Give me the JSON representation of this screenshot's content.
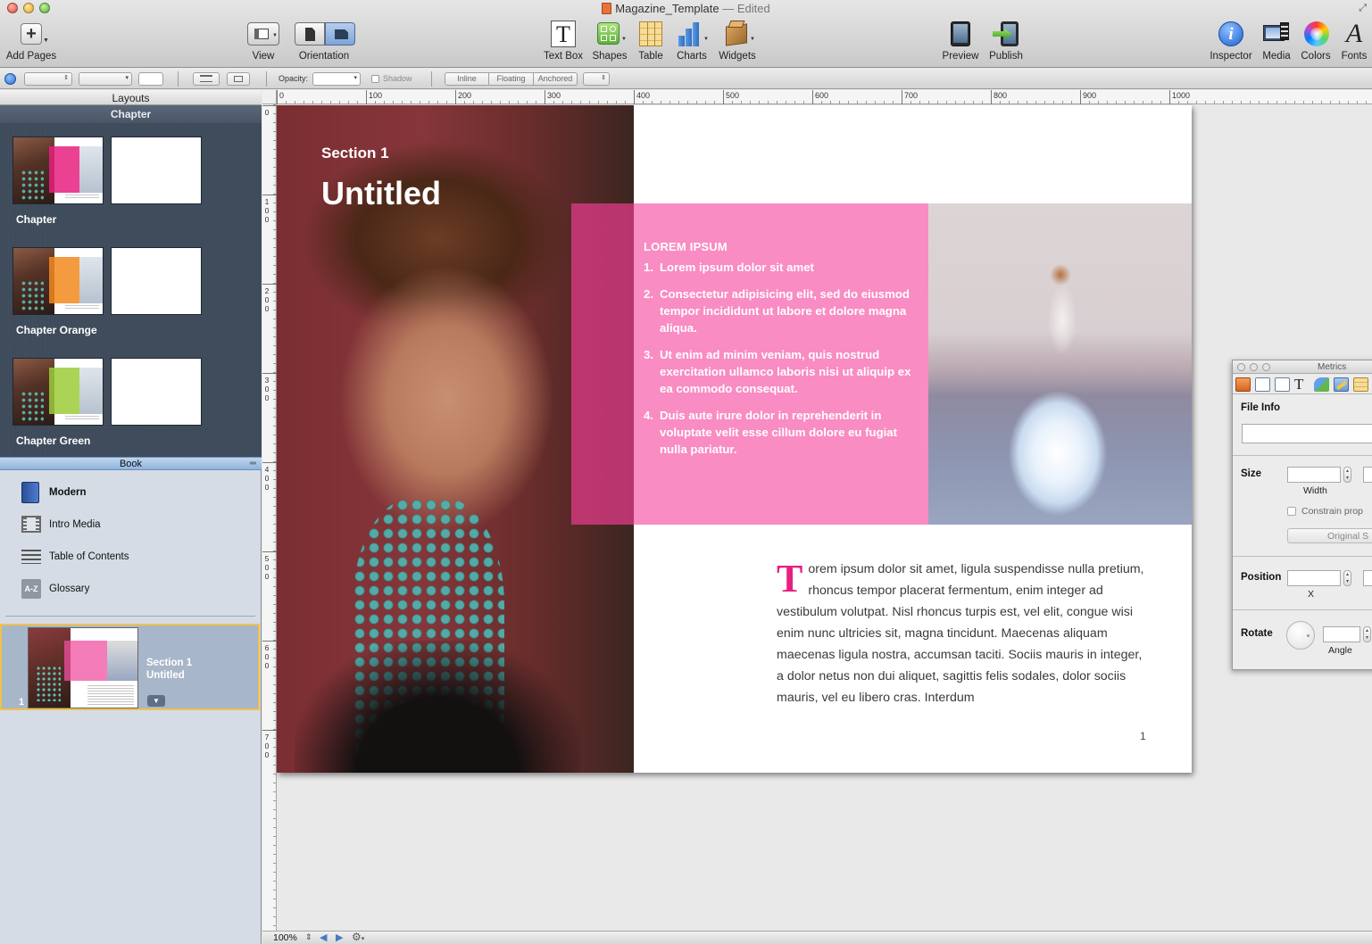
{
  "window": {
    "title": "Magazine_Template",
    "edited": "— Edited"
  },
  "toolbar": {
    "add_pages": "Add Pages",
    "view": "View",
    "orientation": "Orientation",
    "text_box": "Text Box",
    "shapes": "Shapes",
    "table": "Table",
    "charts": "Charts",
    "widgets": "Widgets",
    "preview": "Preview",
    "publish": "Publish",
    "inspector": "Inspector",
    "media": "Media",
    "colors": "Colors",
    "fonts": "Fonts"
  },
  "format_bar": {
    "opacity_label": "Opacity:",
    "shadow_label": "Shadow",
    "wrap_inline": "Inline",
    "wrap_floating": "Floating",
    "wrap_anchored": "Anchored"
  },
  "sidebar": {
    "layouts_header": "Layouts",
    "chapter_bar": "Chapter",
    "layouts": [
      {
        "label": "Chapter",
        "accent": "#e8207f"
      },
      {
        "label": "Chapter Orange",
        "accent": "#f28a1e"
      },
      {
        "label": "Chapter Green",
        "accent": "#9ccc3a"
      }
    ],
    "book_header": "Book",
    "book_items": [
      {
        "label": "Modern",
        "icon": "book-icon"
      },
      {
        "label": "Intro Media",
        "icon": "film-icon"
      },
      {
        "label": "Table of Contents",
        "icon": "list-icon"
      },
      {
        "label": "Glossary",
        "icon": "a-z-icon"
      }
    ],
    "glossary_icon_text": "A-Z",
    "section": {
      "line1": "Section 1",
      "line2": "Untitled",
      "number": "1"
    }
  },
  "rulers": {
    "horizontal": [
      "0",
      "100",
      "200",
      "300",
      "400",
      "500",
      "600",
      "700",
      "800",
      "900",
      "1000"
    ],
    "vertical": [
      "0",
      "100",
      "200",
      "300",
      "400",
      "500",
      "600",
      "700"
    ]
  },
  "page": {
    "kicker": "Section 1",
    "title": "Untitled",
    "box_heading": "LOREM IPSUM",
    "list": [
      {
        "num": "1.",
        "text": "Lorem ipsum dolor sit amet"
      },
      {
        "num": "2.",
        "text": "Consectetur adipisicing elit, sed do eiusmod tempor incididunt ut labore et dolore magna aliqua."
      },
      {
        "num": "3.",
        "text": "Ut enim ad minim veniam, quis nostrud exercitation ullamco laboris nisi ut aliquip ex ea commodo consequat."
      },
      {
        "num": "4.",
        "text": "Duis aute irure dolor in reprehenderit in voluptate velit esse cillum dolore eu fugiat nulla pariatur."
      }
    ],
    "dropcap": "T",
    "body": "orem ipsum dolor sit amet, ligula suspendisse nulla pretium, rhoncus tempor placerat fermentum, enim integer ad vestibulum volutpat. Nisl rhoncus turpis est, vel elit, congue wisi enim nunc ultricies sit, magna tincidunt. Maecenas aliquam maecenas ligula nostra, accumsan taciti. Sociis mauris in integer, a dolor netus non dui aliquet, sagittis felis sodales, dolor sociis mauris, vel eu libero cras. Interdum",
    "page_number": "1",
    "accent_color": "#e8207f"
  },
  "metrics": {
    "title": "Metrics",
    "file_info": "File Info",
    "size": "Size",
    "width": "Width",
    "constrain": "Constrain prop",
    "original_size": "Original S",
    "position": "Position",
    "x": "X",
    "rotate": "Rotate",
    "angle": "Angle"
  },
  "status": {
    "zoom": "100%"
  }
}
